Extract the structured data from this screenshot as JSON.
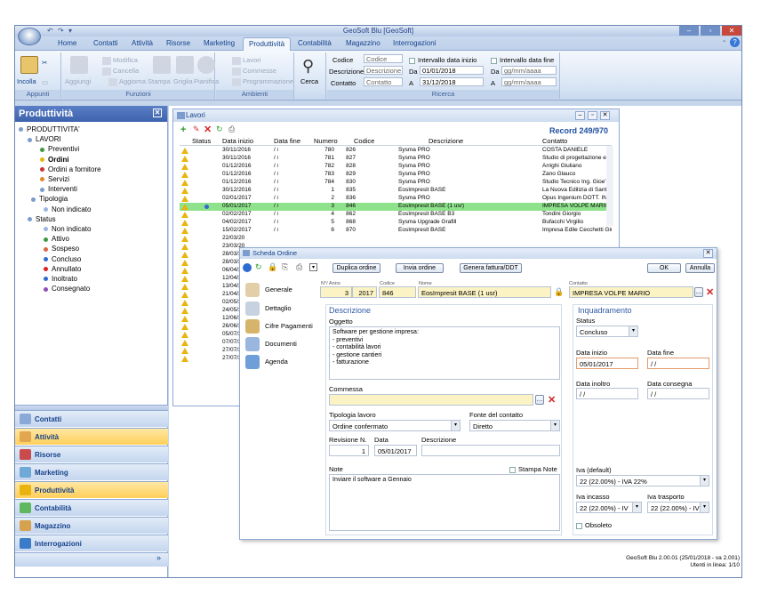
{
  "window": {
    "title": "GeoSoft Blu [GeoSoft]"
  },
  "tabs": [
    "Home",
    "Contatti",
    "Attività",
    "Risorse",
    "Marketing",
    "Produttività",
    "Contabilità",
    "Magazzino",
    "Interrogazioni"
  ],
  "ribbon": {
    "appunti": {
      "label": "Appunti",
      "incolla": "Incolla"
    },
    "funzioni": {
      "label": "Funzioni",
      "aggiungi": "Aggiungi",
      "modifica": "Modifica",
      "cancella": "Cancella",
      "aggiorna": "Aggiorna",
      "stampa": "Stampa",
      "griglia": "Griglia",
      "pianifica": "Pianifica"
    },
    "ambienti": {
      "label": "Ambienti",
      "lavori": "Lavori",
      "commesse": "Commesse",
      "programmazione": "Programmazione"
    },
    "cerca": "Cerca",
    "ricerca": {
      "label": "Ricerca",
      "codice_label": "Codice",
      "codice_placeholder": "Codice",
      "descrizione_label": "Descrizione",
      "descrizione_placeholder": "Descrizione",
      "contatto_label": "Contatto",
      "contatto_placeholder": "Contatto",
      "intervallo_inizio": "Intervallo data inizio",
      "intervallo_fine": "Intervallo data fine",
      "da": "Da",
      "a": "A",
      "da_inizio": "01/01/2018",
      "a_inizio": "31/12/2018",
      "da_fine": "gg/mm/aaaa",
      "a_fine": "gg/mm/aaaa"
    }
  },
  "sidebar": {
    "title": "Produttività",
    "tree": [
      "PRODUTTIVITA'",
      "LAVORI",
      "Preventivi",
      "Ordini",
      "Ordini a fornitore",
      "Servizi",
      "Interventi",
      "Tipologia",
      "Non indicato",
      "Status",
      "Non indicato",
      "Attivo",
      "Sospeso",
      "Concluso",
      "Annullato",
      "Inoltrato",
      "Consegnato"
    ],
    "nav": [
      "Contatti",
      "Attività",
      "Risorse",
      "Marketing",
      "Produttività",
      "Contabilità",
      "Magazzino",
      "Interrogazioni"
    ]
  },
  "lavori": {
    "title": "Lavori",
    "record": "Record 249/970",
    "headers": [
      "Status",
      "Data inizio",
      "Data fine",
      "Numero",
      "Codice",
      "Descrizione",
      "Contatto"
    ],
    "rows": [
      [
        "30/11/2016",
        "/ /",
        "780",
        "826",
        "Sysma PRO",
        "COSTA DANIELE"
      ],
      [
        "30/11/2016",
        "/ /",
        "781",
        "827",
        "Sysma PRO",
        "Studio di progettazione e design M"
      ],
      [
        "01/12/2016",
        "/ /",
        "782",
        "828",
        "Sysma PRO",
        "Arrighi Giuliano"
      ],
      [
        "01/12/2016",
        "/ /",
        "783",
        "829",
        "Sysma PRO",
        "Zano Glauco"
      ],
      [
        "01/12/2016",
        "/ /",
        "784",
        "830",
        "Sysma PRO",
        "Studio Tecnico Ing. Gioe' Frances"
      ],
      [
        "30/12/2016",
        "/ /",
        "1",
        "835",
        "EosImpresit BASE",
        "La Nuova Edilizia di Santacroce Ni"
      ],
      [
        "02/01/2017",
        "/ /",
        "2",
        "836",
        "Sysma PRO",
        "Opus Ingenium DOTT. ING. ARMAI"
      ],
      [
        "05/01/2017",
        "/ /",
        "3",
        "846",
        "EosImpresit BASE (1 usr)",
        "IMPRESA VOLPE MARIO"
      ],
      [
        "02/02/2017",
        "/ /",
        "4",
        "862",
        "EosImpresit BASE B3",
        "Tondini Giorgio"
      ],
      [
        "04/02/2017",
        "/ /",
        "5",
        "868",
        "Sysma Upgrade Grafill",
        "Bufacchi Virgilio"
      ],
      [
        "15/02/2017",
        "/ /",
        "6",
        "870",
        "EosImpresit BASE",
        "Impresa Edile Cecchetti Giuseppe"
      ],
      [
        "22/03/20",
        "",
        "",
        "",
        "",
        ""
      ],
      [
        "23/03/20",
        "",
        "",
        "",
        "",
        ""
      ],
      [
        "28/03/20",
        "",
        "",
        "",
        "",
        ""
      ],
      [
        "28/03/20",
        "",
        "",
        "",
        "",
        ""
      ],
      [
        "06/04/20",
        "",
        "",
        "",
        "",
        ""
      ],
      [
        "12/04/20",
        "",
        "",
        "",
        "",
        ""
      ],
      [
        "13/04/20",
        "",
        "",
        "",
        "",
        ""
      ],
      [
        "21/04/20",
        "",
        "",
        "",
        "",
        ""
      ],
      [
        "02/05/20",
        "",
        "",
        "",
        "",
        ""
      ],
      [
        "24/05/20",
        "",
        "",
        "",
        "",
        ""
      ],
      [
        "12/06/20",
        "",
        "",
        "",
        "",
        ""
      ],
      [
        "26/06/20",
        "",
        "",
        "",
        "",
        ""
      ],
      [
        "05/07/20",
        "",
        "",
        "",
        "",
        ""
      ],
      [
        "07/07/20",
        "",
        "",
        "",
        "",
        ""
      ],
      [
        "27/07/20",
        "",
        "",
        "",
        "",
        ""
      ],
      [
        "27/07/20",
        "",
        "",
        "",
        "",
        ""
      ]
    ]
  },
  "scheda": {
    "title": "Scheda Ordine",
    "btn_duplica": "Duplica ordine",
    "btn_invia": "Invia ordine",
    "btn_genera": "Genera fattura/DDT",
    "btn_ok": "OK",
    "btn_annulla": "Annulla",
    "nav": [
      "Generale",
      "Dettaglio",
      "Cifre Pagamenti",
      "Documenti",
      "Agenda"
    ],
    "lbl_num_anno": "N°/ Anno",
    "lbl_codice": "Codice",
    "lbl_nome": "Nome",
    "lbl_contatto": "Contatto",
    "numero": "3",
    "anno": "2017",
    "codice": "846",
    "nome": "EosImpresit BASE (1 usr)",
    "contatto": "IMPRESA VOLPE MARIO",
    "sec_descrizione": "Descrizione",
    "lbl_oggetto": "Oggetto",
    "oggetto": "Software per gestione impresa:\n- preventivi\n- contabilità lavori\n- gestione cantieri\n- fatturazione",
    "lbl_commessa": "Commessa",
    "lbl_tipologia": "Tipologia lavoro",
    "tipologia": "Ordine confermato",
    "lbl_fonte": "Fonte del contatto",
    "fonte": "Diretto",
    "lbl_revisione": "Revisione N.",
    "revisione": "1",
    "lbl_data": "Data",
    "data": "05/01/2017",
    "lbl_descrizione": "Descrizione",
    "lbl_note": "Note",
    "lbl_stampa_note": "Stampa Note",
    "note": "Inviare il software a Gennaio",
    "sec_inquadramento": "Inquadramento",
    "lbl_status": "Status",
    "status": "Concluso",
    "lbl_data_inizio": "Data inizio",
    "data_inizio": "05/01/2017",
    "lbl_data_fine": "Data fine",
    "data_fine": "/ /",
    "lbl_data_inoltro": "Data inoltro",
    "data_inoltro": "/ /",
    "lbl_data_consegna": "Data consegna",
    "data_consegna": "/ /",
    "lbl_iva_default": "Iva (default)",
    "iva_default": "22 (22.00%) - IVA 22%",
    "lbl_iva_incasso": "Iva incasso",
    "iva_incasso": "22 (22.00%) - IV",
    "lbl_iva_trasporto": "Iva trasporto",
    "iva_trasporto": "22 (22.00%) - IV",
    "lbl_obsoleto": "Obsoleto"
  },
  "footer": {
    "version": "GeoSoft Blu 2.00.01 (25/01/2018 - va 2.001)",
    "users": "Utenti in linea: 1/10"
  }
}
